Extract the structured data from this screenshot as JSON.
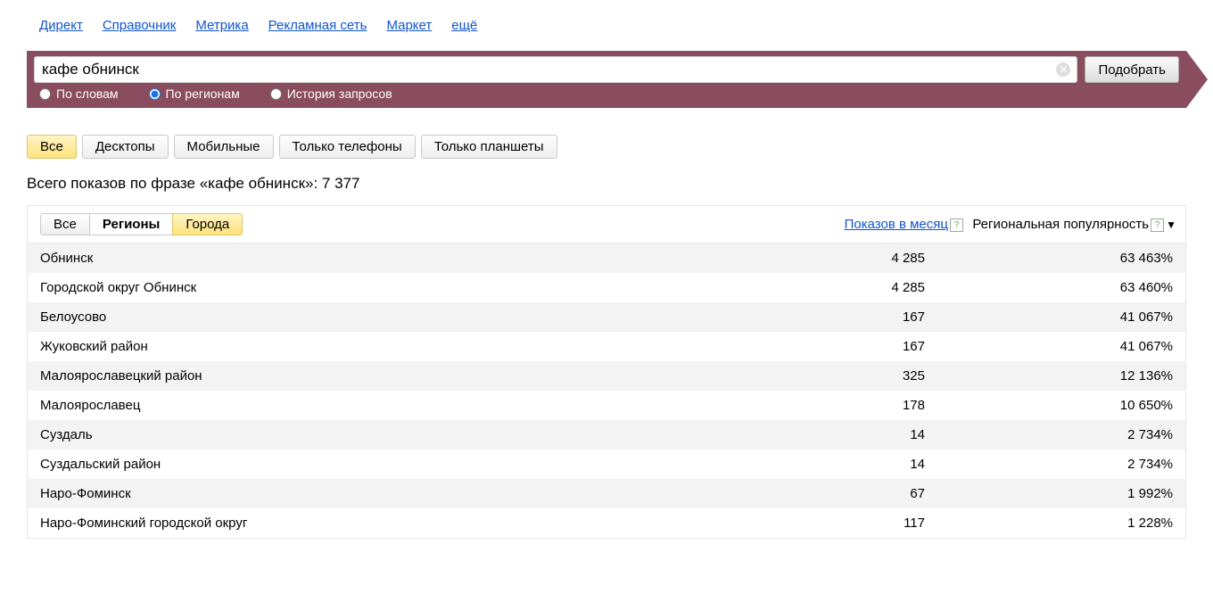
{
  "topnav": {
    "items": [
      "Директ",
      "Справочник",
      "Метрика",
      "Рекламная сеть",
      "Маркет",
      "ещё"
    ]
  },
  "search": {
    "value": "кафе обнинск",
    "submit_label": "Подобрать"
  },
  "modes": {
    "by_words": "По словам",
    "by_regions": "По регионам",
    "history": "История запросов",
    "selected": "by_regions"
  },
  "device_tabs": {
    "items": [
      "Все",
      "Десктопы",
      "Мобильные",
      "Только телефоны",
      "Только планшеты"
    ],
    "active_index": 0
  },
  "totals": {
    "prefix": "Всего показов по фразе «",
    "phrase": "кафе обнинск",
    "suffix": "»: ",
    "count": "7 377"
  },
  "region_tabs": {
    "items": [
      "Все",
      "Регионы",
      "Города"
    ],
    "active_index": 1,
    "yellow_index": 2
  },
  "columns": {
    "impressions": "Показов в месяц",
    "popularity": "Региональная популярность"
  },
  "rows": [
    {
      "region": "Обнинск",
      "impressions": "4 285",
      "popularity": "63 463%"
    },
    {
      "region": "Городской округ Обнинск",
      "impressions": "4 285",
      "popularity": "63 460%"
    },
    {
      "region": "Белоусово",
      "impressions": "167",
      "popularity": "41 067%"
    },
    {
      "region": "Жуковский район",
      "impressions": "167",
      "popularity": "41 067%"
    },
    {
      "region": "Малоярославецкий район",
      "impressions": "325",
      "popularity": "12 136%"
    },
    {
      "region": "Малоярославец",
      "impressions": "178",
      "popularity": "10 650%"
    },
    {
      "region": "Суздаль",
      "impressions": "14",
      "popularity": "2 734%"
    },
    {
      "region": "Суздальский район",
      "impressions": "14",
      "popularity": "2 734%"
    },
    {
      "region": "Наро-Фоминск",
      "impressions": "67",
      "popularity": "1 992%"
    },
    {
      "region": "Наро-Фоминский городской округ",
      "impressions": "117",
      "popularity": "1 228%"
    }
  ]
}
